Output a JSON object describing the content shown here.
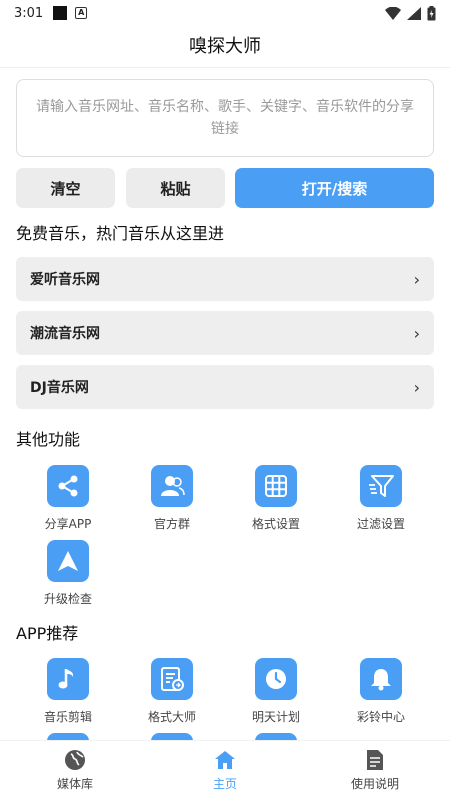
{
  "status": {
    "time": "3:01"
  },
  "header": {
    "title": "嗅探大师"
  },
  "search": {
    "placeholder": "请输入音乐网址、音乐名称、歌手、关键字、音乐软件的分享链接"
  },
  "buttons": {
    "clear": "清空",
    "paste": "粘贴",
    "open": "打开/搜索"
  },
  "free_music": {
    "title": "免费音乐，热门音乐从这里进",
    "sites": [
      {
        "label": "爱听音乐网"
      },
      {
        "label": "潮流音乐网"
      },
      {
        "label": "DJ音乐网"
      }
    ]
  },
  "other_features": {
    "title": "其他功能",
    "items": [
      {
        "label": "分享APP",
        "icon": "share-icon"
      },
      {
        "label": "官方群",
        "icon": "group-icon"
      },
      {
        "label": "格式设置",
        "icon": "grid-icon"
      },
      {
        "label": "过滤设置",
        "icon": "filter-icon"
      },
      {
        "label": "升级检查",
        "icon": "navigation-arrow-icon"
      }
    ]
  },
  "app_recommend": {
    "title": "APP推荐",
    "items": [
      {
        "label": "音乐剪辑",
        "icon": "music-note-icon"
      },
      {
        "label": "格式大师",
        "icon": "document-convert-icon"
      },
      {
        "label": "明天计划",
        "icon": "clock-icon"
      },
      {
        "label": "彩铃中心",
        "icon": "bell-icon"
      }
    ]
  },
  "tabs": [
    {
      "label": "媒体库",
      "icon": "globe-icon"
    },
    {
      "label": "主页",
      "icon": "home-icon",
      "active": true
    },
    {
      "label": "使用说明",
      "icon": "document-icon"
    }
  ],
  "colors": {
    "accent": "#4a9ff5",
    "button_gray": "#ececec"
  }
}
